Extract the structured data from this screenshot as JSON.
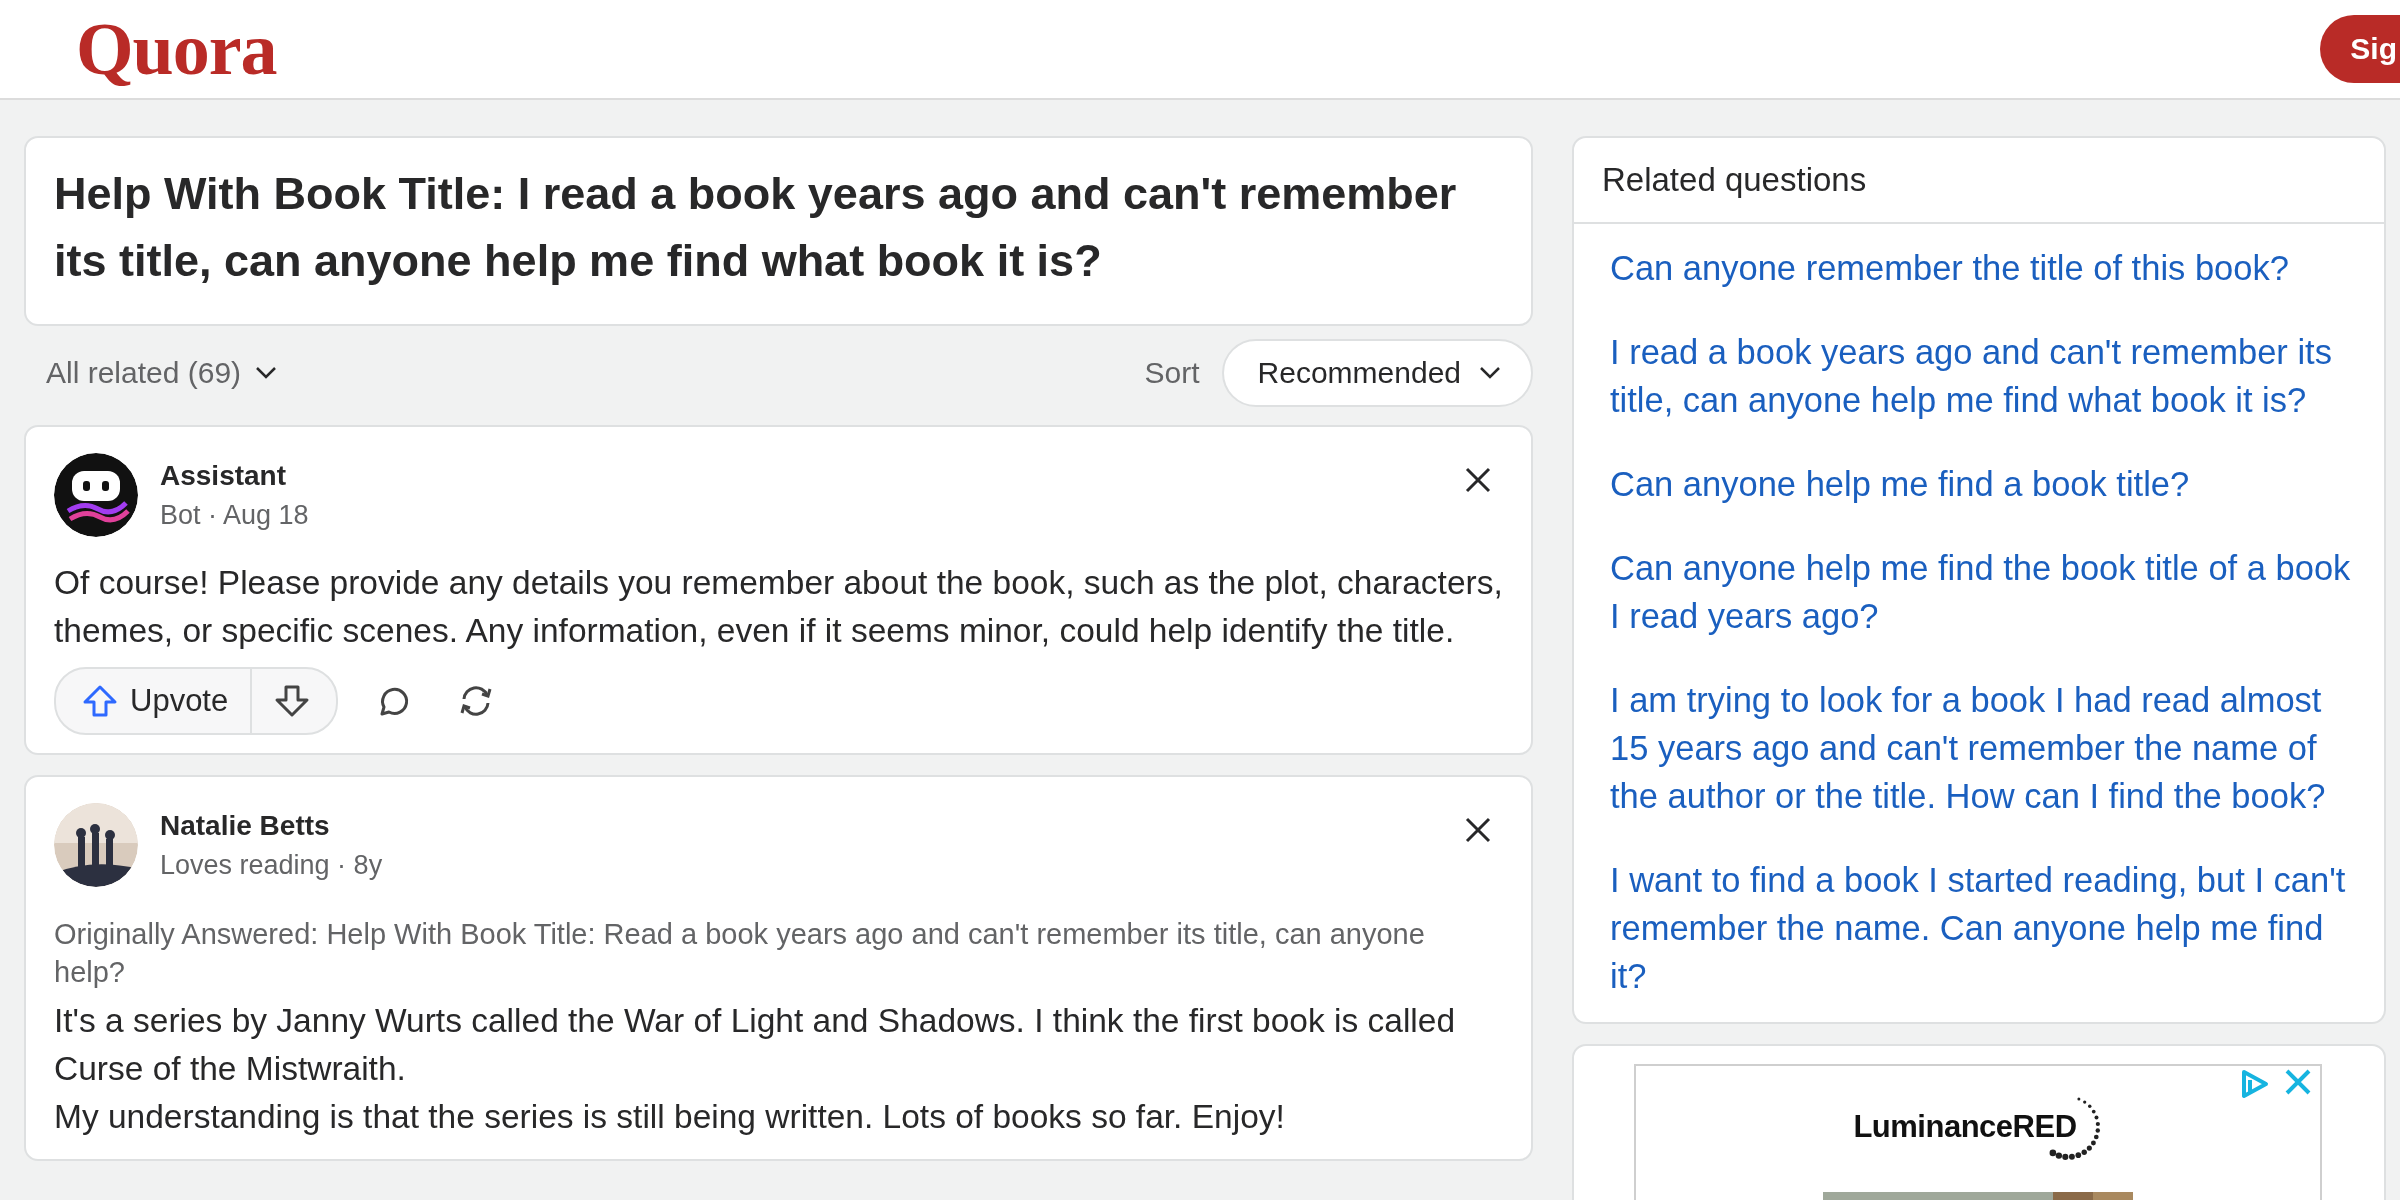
{
  "header": {
    "logo": "Quora",
    "sign_in_button": "Sig"
  },
  "question": {
    "title": "Help With Book Title: I read a book years ago and can't remember its title, can anyone help me find what book it is?"
  },
  "filter_bar": {
    "all_related": "All related (69)",
    "sort_label": "Sort",
    "sort_value": "Recommended"
  },
  "answers": [
    {
      "kind": "bot",
      "author": "Assistant",
      "meta": "Bot · Aug 18",
      "paragraphs": [
        "Of course! Please provide any details you remember about the book, such as the plot, characters, themes, or specific scenes. Any information, even if it seems minor, could help identify the title."
      ],
      "actions": {
        "upvote": "Upvote"
      }
    },
    {
      "kind": "picture",
      "author": "Natalie Betts",
      "meta": "Loves reading · 8y",
      "original_question": "Originally Answered: Help With Book Title: Read a book years ago and can't remember its title, can anyone help?",
      "paragraphs": [
        "It's a series by Janny Wurts called the War of Light and Shadows. I think the first book is called Curse of the Mistwraith.",
        "My understanding is that the series is still being written. Lots of books so far. Enjoy!"
      ]
    }
  ],
  "related_questions": {
    "title": "Related questions",
    "items": [
      "Can anyone remember the title of this book?",
      "I read a book years ago and can't remember its title, can anyone help me find what book it is?",
      "Can anyone help me find a book title?",
      "Can anyone help me find the book title of a book I read years ago?",
      "I am trying to look for a book I had read almost 15 years ago and can't remember the name of the author or the title. How can I find the book?",
      "I want to find a book I started reading, but I can't remember the name. Can anyone help me find it?"
    ]
  },
  "ad": {
    "brand": "LuminanceRED",
    "kind": "picture"
  }
}
